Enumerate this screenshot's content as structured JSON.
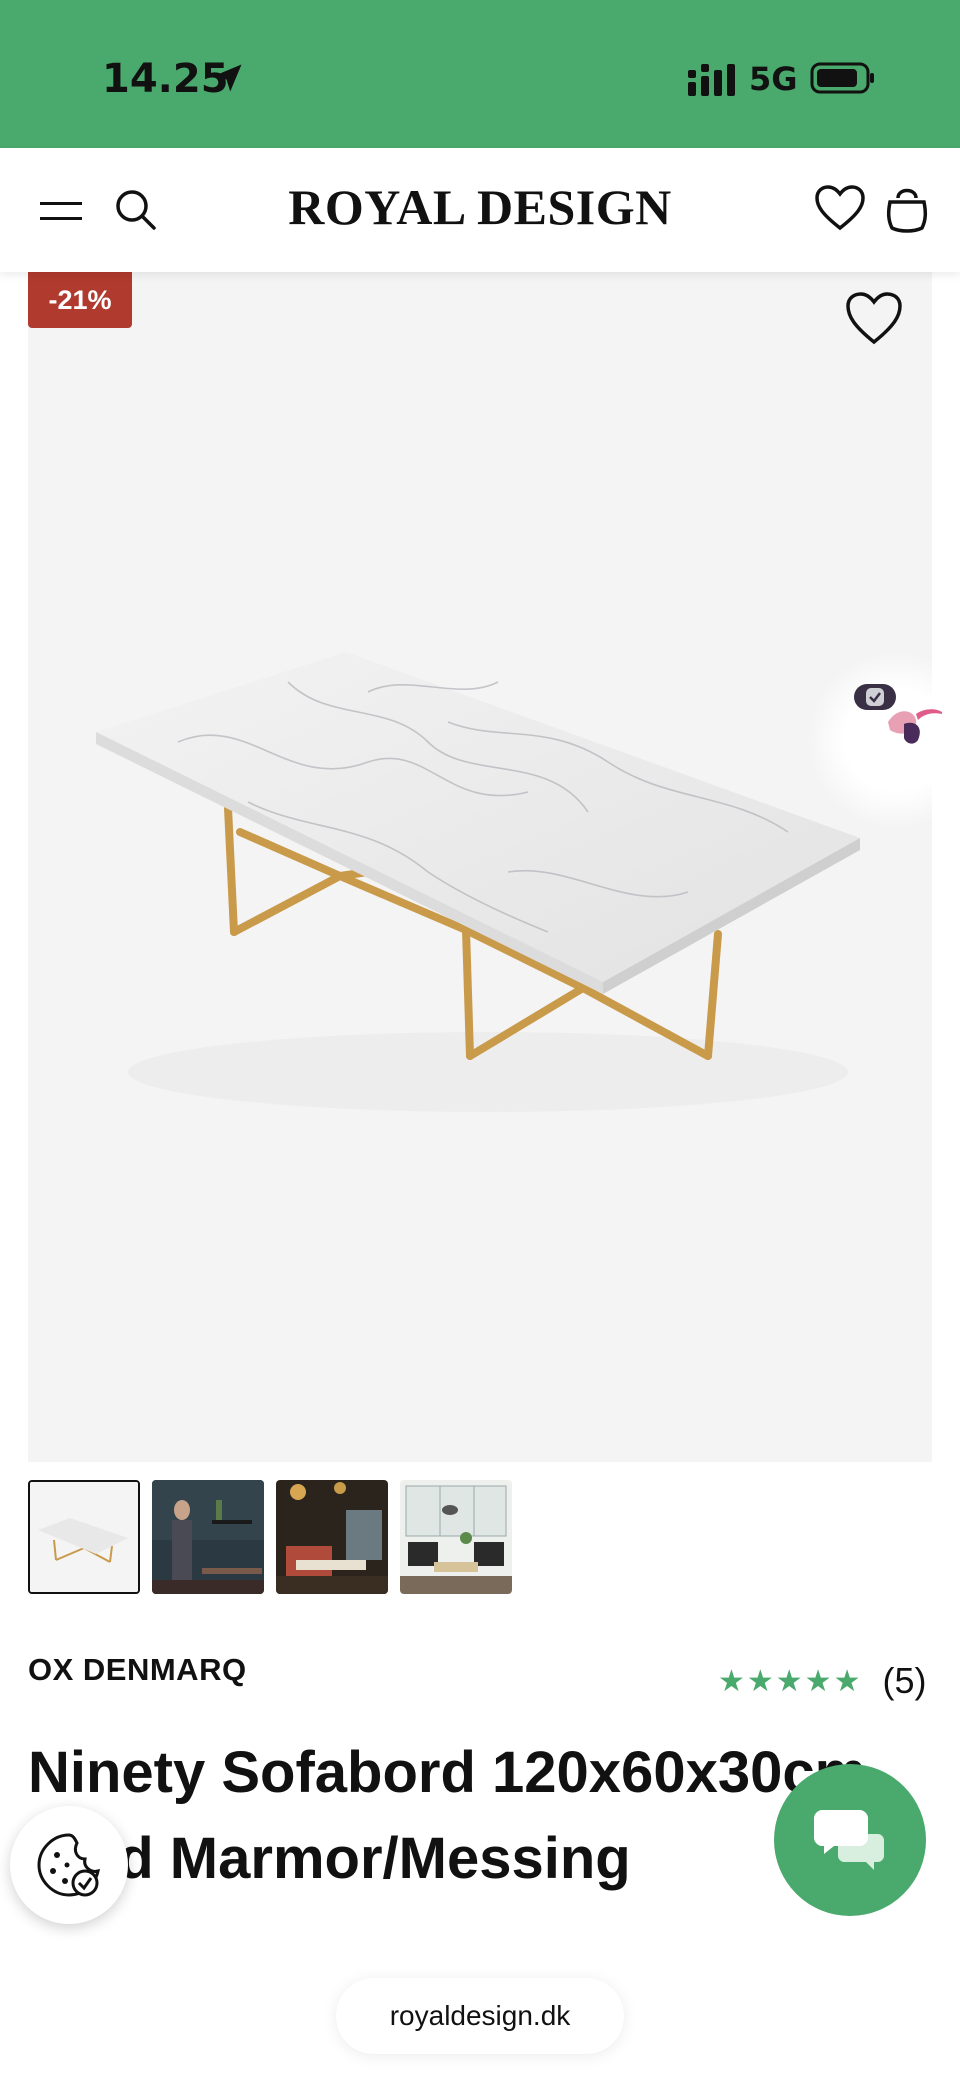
{
  "status_bar": {
    "time": "14.25",
    "network": "5G",
    "background_color": "#4aa96c"
  },
  "header": {
    "logo": "ROYAL DESIGN",
    "icons": [
      "menu-icon",
      "search-icon",
      "heart-icon",
      "shopping-bag-icon"
    ]
  },
  "product_gallery": {
    "discount_badge": "-21%",
    "badge_color": "#b03a2e",
    "main_image": "white marble coffee table with brass base",
    "thumbnails": [
      {
        "label": "table on white background",
        "active": true
      },
      {
        "label": "person in dark interior",
        "active": false
      },
      {
        "label": "lounge with pendant lights",
        "active": false
      },
      {
        "label": "bright living room",
        "active": false
      }
    ]
  },
  "product": {
    "brand": "OX DENMARQ",
    "rating_stars": 5,
    "rating_count": "(5)",
    "title": "Ninety Sofabord 120x60x30cm, Hvid Marmor/Messing",
    "star_color": "#4aa96c"
  },
  "floating": {
    "chat_color": "#4aa96c",
    "cookie_icon": "cookie-settings-icon"
  },
  "browser": {
    "url": "royaldesign.dk"
  }
}
